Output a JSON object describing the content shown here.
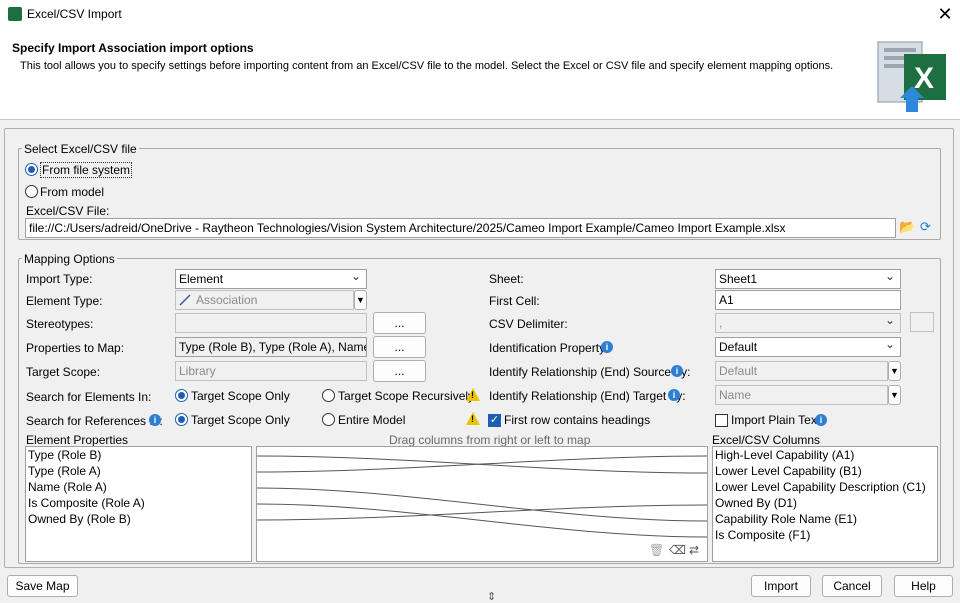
{
  "window": {
    "title": "Excel/CSV Import",
    "close": "✕"
  },
  "header": {
    "title": "Specify Import Association import options",
    "description": "This tool allows you to specify settings before importing content from an Excel/CSV file to the model. Select the Excel or CSV file and specify element mapping options."
  },
  "select_file": {
    "legend": "Select Excel/CSV file",
    "option_fs": "From file system",
    "option_model": "From model",
    "file_label": "Excel/CSV File:",
    "file_value": "file://C:/Users/adreid/OneDrive - Raytheon Technologies/Vision System Architecture/2025/Cameo Import Example/Cameo Import Example.xlsx"
  },
  "mapping": {
    "legend": "Mapping Options",
    "import_type_label": "Import Type:",
    "import_type_value": "Element",
    "element_type_label": "Element Type:",
    "element_type_value": "Association",
    "stereotypes_label": "Stereotypes:",
    "props_label": "Properties to Map:",
    "props_value": "Type (Role B), Type (Role A), Name (Rol",
    "target_scope_label": "Target Scope:",
    "target_scope_placeholder": "Library",
    "ellipsis": "...",
    "search_elements_label": "Search for Elements In:",
    "search_refs_label": "Search for References In:",
    "target_scope_only": "Target Scope Only",
    "target_scope_recursive": "Target Scope Recursively",
    "entire_model": "Entire Model",
    "sheet_label": "Sheet:",
    "sheet_value": "Sheet1",
    "first_cell_label": "First Cell:",
    "first_cell_value": "A1",
    "csv_delim_label": "CSV Delimiter:",
    "csv_delim_value": ",",
    "id_prop_label": "Identification Property:",
    "id_prop_value": "Default",
    "rel_source_label": "Identify Relationship (End) Source by:",
    "rel_source_value": "Default",
    "rel_target_label": "Identify Relationship (End) Target by:",
    "rel_target_value": "Name",
    "first_row_headings": "First row contains headings",
    "import_plain_text": "Import Plain Text",
    "element_props_label": "Element Properties",
    "drag_hint": "Drag columns from right or left to map",
    "excel_cols_label": "Excel/CSV Columns",
    "element_props": [
      "Type (Role B)",
      "Type (Role A)",
      "Name (Role A)",
      "Is Composite (Role A)",
      "Owned By (Role B)"
    ],
    "excel_cols": [
      "High-Level Capability (A1)",
      "Lower Level Capability (B1)",
      "Lower Level Capability Description (C1)",
      "Owned By (D1)",
      "Capability Role Name (E1)",
      "Is Composite (F1)"
    ]
  },
  "footer": {
    "save_map": "Save Map",
    "import": "Import",
    "cancel": "Cancel",
    "help": "Help"
  },
  "colors": {
    "accent": "#1a5fb4",
    "excel_green": "#1d6f42",
    "warning": "#e8c400",
    "info": "#2d7fd3"
  }
}
